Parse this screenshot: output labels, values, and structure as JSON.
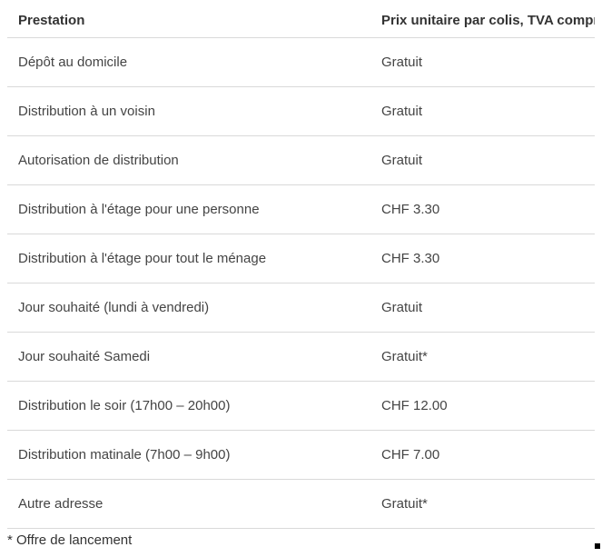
{
  "table": {
    "headers": {
      "prestation": "Prestation",
      "prix": "Prix unitaire par colis, TVA comprise"
    },
    "rows": [
      {
        "prestation": "Dépôt au domicile",
        "prix": "Gratuit"
      },
      {
        "prestation": "Distribution à un voisin",
        "prix": "Gratuit"
      },
      {
        "prestation": "Autorisation de distribution",
        "prix": "Gratuit"
      },
      {
        "prestation": "Distribution à l'étage pour une personne",
        "prix": "CHF 3.30"
      },
      {
        "prestation": "Distribution à l'étage pour tout le ménage",
        "prix": "CHF 3.30"
      },
      {
        "prestation": "Jour souhaité (lundi à vendredi)",
        "prix": "Gratuit"
      },
      {
        "prestation": "Jour souhaité Samedi",
        "prix": "Gratuit*"
      },
      {
        "prestation": "Distribution le soir (17h00 – 20h00)",
        "prix": "CHF 12.00"
      },
      {
        "prestation": "Distribution matinale (7h00 – 9h00)",
        "prix": "CHF 7.00"
      },
      {
        "prestation": "Autre adresse",
        "prix": "Gratuit*"
      }
    ]
  },
  "footnote": "* Offre de lancement"
}
